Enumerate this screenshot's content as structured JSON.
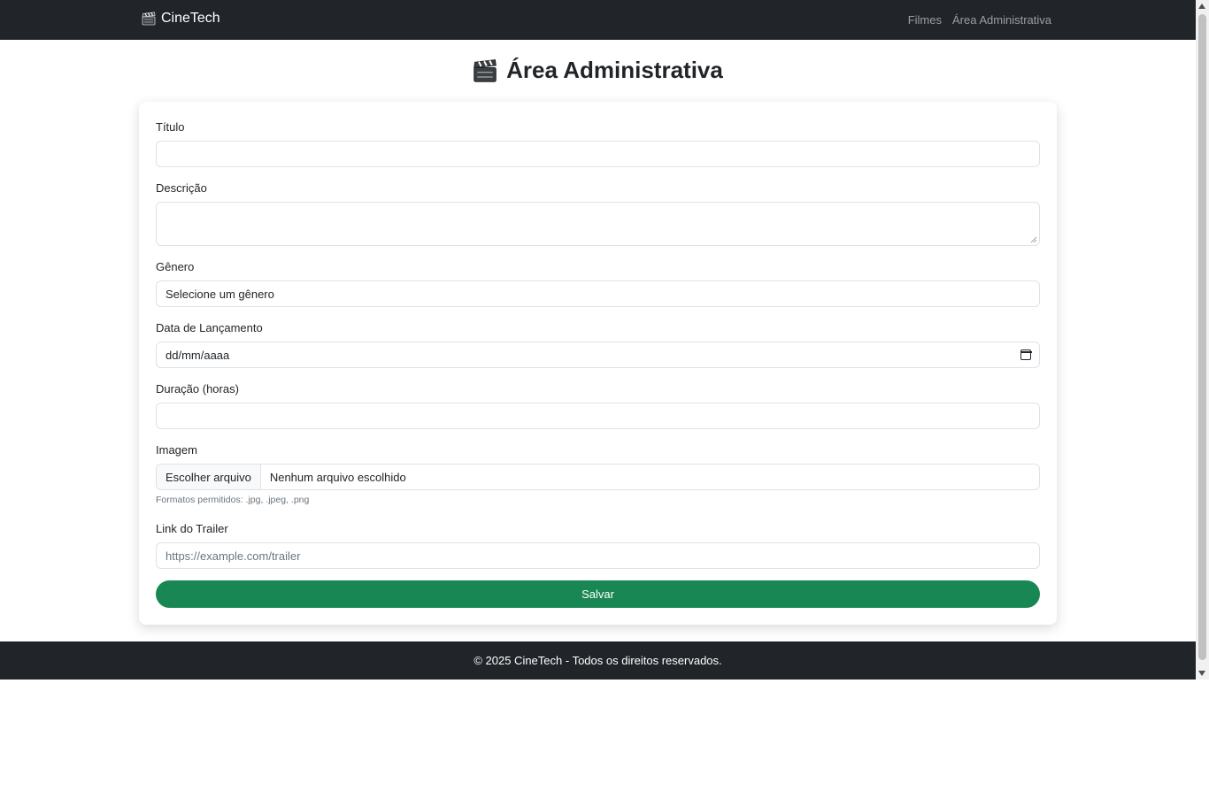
{
  "navbar": {
    "brand": "CineTech",
    "brand_icon": "clapperboard-icon",
    "links": [
      "Filmes",
      "Área Administrativa"
    ]
  },
  "page": {
    "title": "Área Administrativa",
    "title_icon": "clapperboard-icon"
  },
  "form": {
    "titulo_label": "Título",
    "titulo_value": "",
    "descricao_label": "Descrição",
    "descricao_value": "",
    "genero_label": "Gênero",
    "genero_selected": "Selecione um gênero",
    "data_label": "Data de Lançamento",
    "data_placeholder": "dd/mm/aaaa",
    "duracao_label": "Duração (horas)",
    "duracao_value": "",
    "imagem_label": "Imagem",
    "file_button": "Escolher arquivo",
    "file_status": "Nenhum arquivo escolhido",
    "imagem_hint": "Formatos permitidos: .jpg, .jpeg, .png",
    "trailer_label": "Link do Trailer",
    "trailer_placeholder": "https://example.com/trailer",
    "submit_label": "Salvar"
  },
  "footer": {
    "text": "© 2025 CineTech - Todos os direitos reservados."
  },
  "colors": {
    "navbar_bg": "#212529",
    "submit_bg": "#198754",
    "nav_link": "rgba(255,255,255,0.55)"
  }
}
